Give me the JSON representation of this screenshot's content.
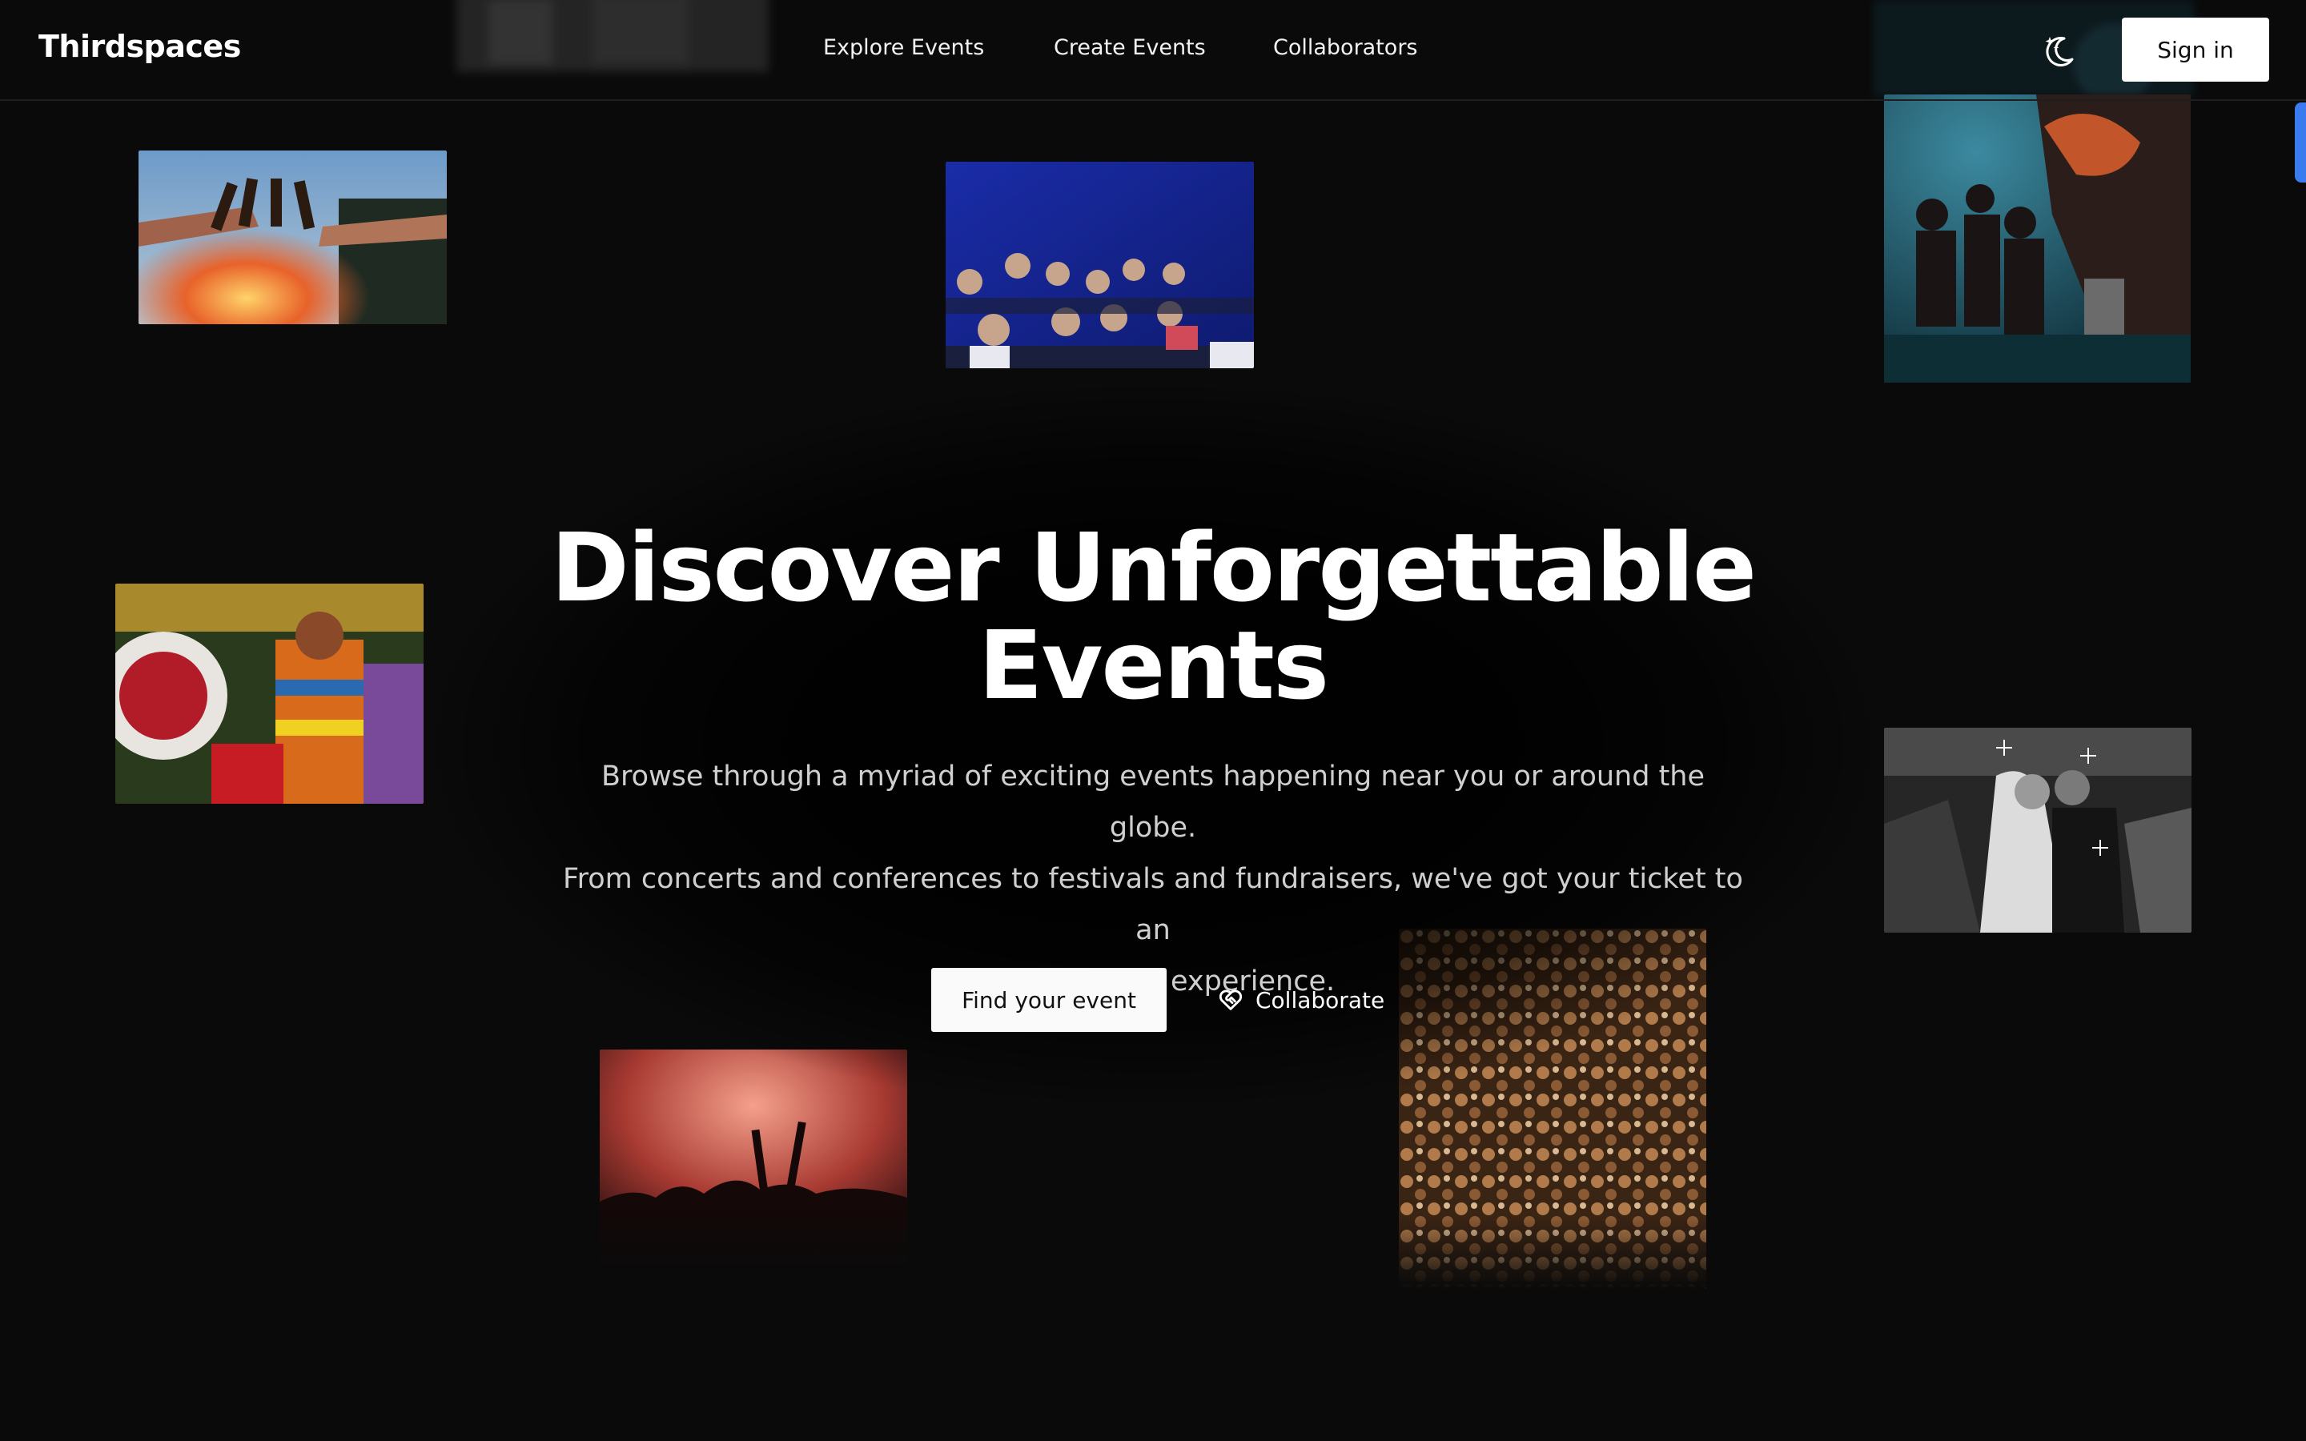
{
  "header": {
    "logo": "Thirdspaces",
    "nav": [
      "Explore Events",
      "Create Events",
      "Collaborators"
    ],
    "theme_toggle_icon": "moon-stars-icon",
    "sign_in_label": "Sign in"
  },
  "hero": {
    "title_line1": "Discover Unforgettable",
    "title_line2": "Events",
    "subtitle_line1": "Browse through a myriad of exciting events happening near you or around the globe.",
    "subtitle_line2": "From concerts and conferences to festivals and fundraisers, we've got your ticket to an",
    "subtitle_line3": "unforgettable experience.",
    "primary_button": "Find your event",
    "secondary_button": "Collaborate",
    "secondary_button_icon": "heart-handshake-icon"
  },
  "colors": {
    "background": "#0a0a0a",
    "text": "#ffffff",
    "muted_text": "#cfcfcf",
    "button_bg": "#fafafa",
    "accent_tab": "#3b7bf0"
  }
}
